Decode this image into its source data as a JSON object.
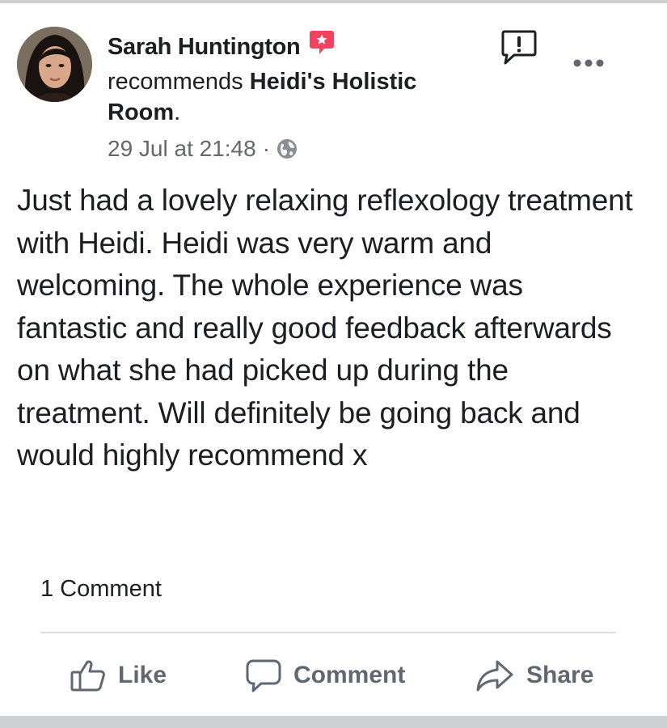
{
  "post": {
    "author": "Sarah Huntington",
    "recommend_verb": "recommends",
    "page_name": "Heidi's Holistic Room",
    "page_suffix": ".",
    "timestamp": "29 Jul at 21:48",
    "separator": "·",
    "privacy_icon": "globe-icon",
    "badge_icon": "recommendation-badge-icon",
    "body": "Just had a lovely relaxing reflexology treatment with Heidi. Heidi was very warm and welcoming. The whole experience was fantastic and really good feedback afterwards on what she had picked up during the treatment. Will definitely be going back and would highly recommend x"
  },
  "header_icons": {
    "report": "report-icon",
    "more": "more-options-icon"
  },
  "stats": {
    "comments": "1 Comment"
  },
  "actions": {
    "like": "Like",
    "comment": "Comment",
    "share": "Share"
  },
  "colors": {
    "text": "#1c1e21",
    "secondary": "#65676b",
    "action_gray": "#606770",
    "badge": "#f3425f",
    "divider": "#dadde1"
  }
}
